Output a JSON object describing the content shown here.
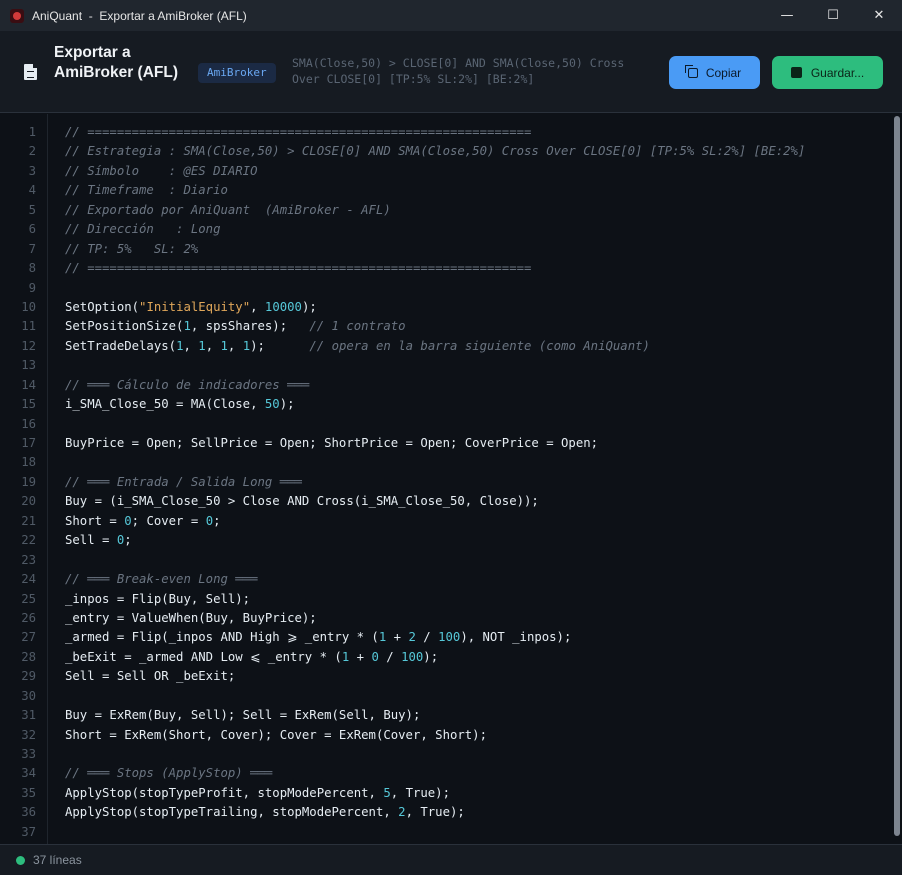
{
  "window": {
    "app_name": "AniQuant",
    "separator": "-",
    "title": "Exportar a AmiBroker (AFL)",
    "controls": {
      "minimize": "—",
      "maximize": "☐",
      "close": "✕"
    }
  },
  "header": {
    "title": "Exportar a AmiBroker (AFL)",
    "badge": "AmiBroker",
    "strategy": "SMA(Close,50) > CLOSE[0] AND SMA(Close,50) Cross Over CLOSE[0] [TP:5% SL:2%] [BE:2%]",
    "copy_label": "Copiar",
    "save_label": "Guardar...",
    "icons": {
      "title": "document-icon",
      "copy": "copy-icon",
      "save": "save-icon"
    }
  },
  "colors": {
    "copy_button": "#4a9bf5",
    "save_button": "#2dbd7e",
    "badge_text": "#6aa8f2",
    "comment": "#6b7582",
    "string": "#e0a75a",
    "number": "#56c8d8",
    "status_dot": "#2dbd7e"
  },
  "code_lines": [
    [
      [
        "c",
        "// ============================================================"
      ]
    ],
    [
      [
        "c",
        "// Estrategia : SMA(Close,50) > CLOSE[0] AND SMA(Close,50) Cross Over CLOSE[0] [TP:5% SL:2%] [BE:2%]"
      ]
    ],
    [
      [
        "c",
        "// Símbolo    : @ES DIARIO"
      ]
    ],
    [
      [
        "c",
        "// Timeframe  : Diario"
      ]
    ],
    [
      [
        "c",
        "// Exportado por AniQuant  (AmiBroker - AFL)"
      ]
    ],
    [
      [
        "c",
        "// Dirección   : Long"
      ]
    ],
    [
      [
        "c",
        "// TP: 5%   SL: 2%"
      ]
    ],
    [
      [
        "c",
        "// ============================================================"
      ]
    ],
    [],
    [
      [
        "p",
        "SetOption("
      ],
      [
        "s",
        "\"InitialEquity\""
      ],
      [
        "p",
        ", "
      ],
      [
        "n",
        "10000"
      ],
      [
        "p",
        ");"
      ]
    ],
    [
      [
        "p",
        "SetPositionSize("
      ],
      [
        "n",
        "1"
      ],
      [
        "p",
        ", spsShares);   "
      ],
      [
        "c",
        "// 1 contrato"
      ]
    ],
    [
      [
        "p",
        "SetTradeDelays("
      ],
      [
        "n",
        "1"
      ],
      [
        "p",
        ", "
      ],
      [
        "n",
        "1"
      ],
      [
        "p",
        ", "
      ],
      [
        "n",
        "1"
      ],
      [
        "p",
        ", "
      ],
      [
        "n",
        "1"
      ],
      [
        "p",
        ");      "
      ],
      [
        "c",
        "// opera en la barra siguiente (como AniQuant)"
      ]
    ],
    [],
    [
      [
        "c",
        "// ═══ Cálculo de indicadores ═══"
      ]
    ],
    [
      [
        "p",
        "i_SMA_Close_50 = MA(Close, "
      ],
      [
        "n",
        "50"
      ],
      [
        "p",
        ");"
      ]
    ],
    [],
    [
      [
        "p",
        "BuyPrice = Open; SellPrice = Open; ShortPrice = Open; CoverPrice = Open;"
      ]
    ],
    [],
    [
      [
        "c",
        "// ═══ Entrada / Salida Long ═══"
      ]
    ],
    [
      [
        "p",
        "Buy = (i_SMA_Close_50 > Close AND Cross(i_SMA_Close_50, Close));"
      ]
    ],
    [
      [
        "p",
        "Short = "
      ],
      [
        "n",
        "0"
      ],
      [
        "p",
        "; Cover = "
      ],
      [
        "n",
        "0"
      ],
      [
        "p",
        ";"
      ]
    ],
    [
      [
        "p",
        "Sell = "
      ],
      [
        "n",
        "0"
      ],
      [
        "p",
        ";"
      ]
    ],
    [],
    [
      [
        "c",
        "// ═══ Break-even Long ═══"
      ]
    ],
    [
      [
        "p",
        "_inpos = Flip(Buy, Sell);"
      ]
    ],
    [
      [
        "p",
        "_entry = ValueWhen(Buy, BuyPrice);"
      ]
    ],
    [
      [
        "p",
        "_armed = Flip(_inpos AND High ⩾ _entry * ("
      ],
      [
        "n",
        "1"
      ],
      [
        "p",
        " + "
      ],
      [
        "n",
        "2"
      ],
      [
        "p",
        " / "
      ],
      [
        "n",
        "100"
      ],
      [
        "p",
        "), NOT _inpos);"
      ]
    ],
    [
      [
        "p",
        "_beExit = _armed AND Low ⩽ _entry * ("
      ],
      [
        "n",
        "1"
      ],
      [
        "p",
        " + "
      ],
      [
        "n",
        "0"
      ],
      [
        "p",
        " / "
      ],
      [
        "n",
        "100"
      ],
      [
        "p",
        ");"
      ]
    ],
    [
      [
        "p",
        "Sell = Sell OR _beExit;"
      ]
    ],
    [],
    [
      [
        "p",
        "Buy = ExRem(Buy, Sell); Sell = ExRem(Sell, Buy);"
      ]
    ],
    [
      [
        "p",
        "Short = ExRem(Short, Cover); Cover = ExRem(Cover, Short);"
      ]
    ],
    [],
    [
      [
        "c",
        "// ═══ Stops (ApplyStop) ═══"
      ]
    ],
    [
      [
        "p",
        "ApplyStop(stopTypeProfit, stopModePercent, "
      ],
      [
        "n",
        "5"
      ],
      [
        "p",
        ", True);"
      ]
    ],
    [
      [
        "p",
        "ApplyStop(stopTypeTrailing, stopModePercent, "
      ],
      [
        "n",
        "2"
      ],
      [
        "p",
        ", True);"
      ]
    ],
    []
  ],
  "status": {
    "text": "37 líneas"
  }
}
